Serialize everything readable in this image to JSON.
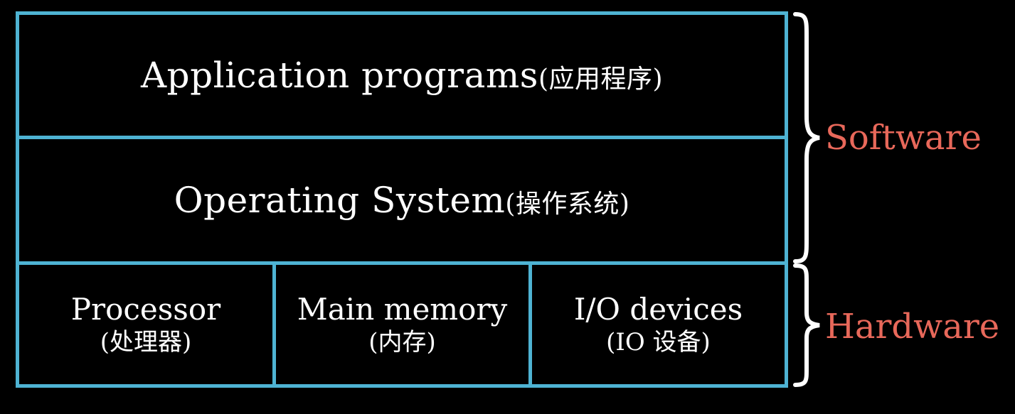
{
  "colors": {
    "background": "#000000",
    "box_border": "#4eb3d3",
    "text": "#ffffff",
    "label": "#e8685a",
    "brace": "#ffffff"
  },
  "layers": {
    "application": {
      "en": "Application programs",
      "cn": "(应用程序)"
    },
    "os": {
      "en": "Operating System",
      "cn": "(操作系统)"
    }
  },
  "hardware": [
    {
      "en": "Processor",
      "cn": "(处理器)"
    },
    {
      "en": "Main memory",
      "cn": "(内存)"
    },
    {
      "en": "I/O devices",
      "cn": "(IO 设备)"
    }
  ],
  "labels": {
    "software": "Software",
    "hardware": "Hardware"
  },
  "icons": {
    "software_brace": "right-curly-brace",
    "hardware_brace": "right-curly-brace"
  }
}
